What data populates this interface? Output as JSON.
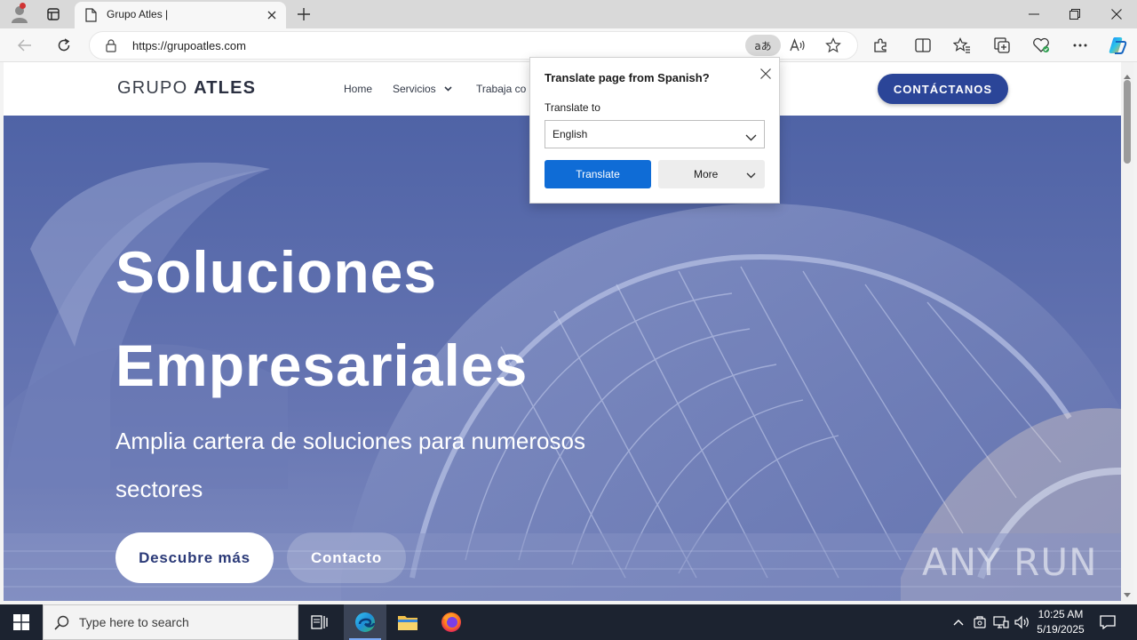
{
  "browser": {
    "tab_title": "Grupo Atles |",
    "url": "https://grupoatles.com",
    "translate_pill_glyph": "aあ",
    "icons": [
      "profile-icon",
      "tab-actions-icon",
      "page-icon",
      "close-icon",
      "new-tab-icon",
      "back-icon",
      "refresh-icon",
      "lock-icon",
      "read-aloud-icon",
      "favorite-star-icon",
      "extensions-icon",
      "split-screen-icon",
      "favorites-icon",
      "collections-icon",
      "browser-essentials-icon",
      "more-icon",
      "copilot-icon"
    ]
  },
  "site": {
    "logo_light": "GRUPO ",
    "logo_bold": "ATLES",
    "nav": {
      "home": "Home",
      "servicios": "Servicios",
      "trabaja": "Trabaja co"
    },
    "cta_label": "CONTÁCTANOS",
    "hero": {
      "title_line1": "Soluciones",
      "title_line2": "Empresariales",
      "subtitle_line1": "Amplia cartera de soluciones para numerosos",
      "subtitle_line2": "sectores",
      "primary_button": "Descubre más",
      "secondary_button": "Contacto"
    },
    "watermark": "ANY RUN"
  },
  "translate_popup": {
    "title": "Translate page from Spanish?",
    "label": "Translate to",
    "selected_language": "English",
    "translate_button": "Translate",
    "more_button": "More"
  },
  "taskbar": {
    "search_placeholder": "Type here to search",
    "time": "10:25 AM",
    "date": "5/19/2025"
  },
  "colors": {
    "cta_blue": "#2b4598",
    "translate_blue": "#0f6cd6",
    "hero_tint": "#5d6fae",
    "taskbar": "#1c2330"
  }
}
